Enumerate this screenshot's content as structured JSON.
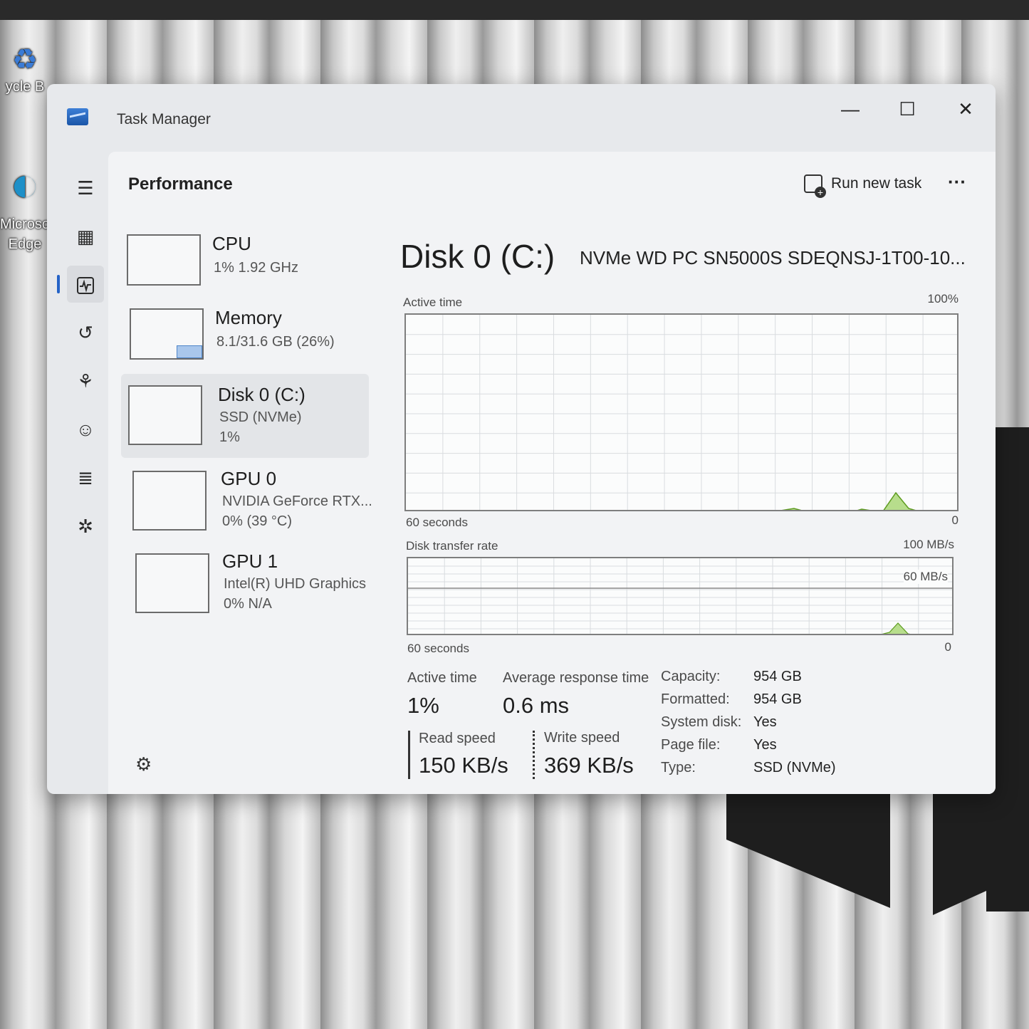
{
  "desktop": {
    "icons": [
      {
        "label": "ycle B"
      },
      {
        "label": "Microsoft Edge"
      }
    ]
  },
  "window": {
    "title": "Task Manager",
    "controls": {
      "minimize": "—",
      "maximize": "☐",
      "close": "✕"
    }
  },
  "nav": {
    "items": [
      "menu",
      "processes",
      "performance",
      "app-history",
      "startup-apps",
      "users",
      "details",
      "services"
    ],
    "active": "performance"
  },
  "header": {
    "title": "Performance",
    "run_new_task": "Run new task",
    "more": "···"
  },
  "sidebar": {
    "devices": [
      {
        "name": "CPU",
        "line1": "1%  1.92 GHz",
        "line2": ""
      },
      {
        "name": "Memory",
        "line1": "8.1/31.6 GB (26%)",
        "line2": ""
      },
      {
        "name": "Disk 0 (C:)",
        "line1": "SSD (NVMe)",
        "line2": "1%"
      },
      {
        "name": "GPU 0",
        "line1": "NVIDIA GeForce RTX...",
        "line2": "0%  (39 °C)"
      },
      {
        "name": "GPU 1",
        "line1": "Intel(R) UHD Graphics",
        "line2": "0%  N/A"
      }
    ],
    "selected": "Disk 0 (C:)",
    "memory_usage_fraction": 0.26
  },
  "detail": {
    "title": "Disk 0 (C:)",
    "model": "NVMe WD PC SN5000S SDEQNSJ-1T00-10...",
    "active_time_graph": {
      "label": "Active time",
      "max_label": "100%",
      "x_left_label": "60 seconds",
      "x_right_label": "0"
    },
    "transfer_rate_graph": {
      "label": "Disk transfer rate",
      "max_label": "100 MB/s",
      "mid_label": "60 MB/s",
      "x_left_label": "60 seconds",
      "x_right_label": "0"
    },
    "stats": {
      "active_time_label": "Active time",
      "active_time_value": "1%",
      "avg_response_label": "Average response time",
      "avg_response_value": "0.6 ms",
      "read_speed_label": "Read speed",
      "read_speed_value": "150 KB/s",
      "write_speed_label": "Write speed",
      "write_speed_value": "369 KB/s"
    },
    "properties": [
      {
        "key": "Capacity:",
        "value": "954 GB"
      },
      {
        "key": "Formatted:",
        "value": "954 GB"
      },
      {
        "key": "System disk:",
        "value": "Yes"
      },
      {
        "key": "Page file:",
        "value": "Yes"
      },
      {
        "key": "Type:",
        "value": "SSD (NVMe)"
      }
    ]
  },
  "colors": {
    "graph_fill": "#b7dd8c",
    "graph_line": "#5d9c1f",
    "accent": "#2563c7"
  }
}
